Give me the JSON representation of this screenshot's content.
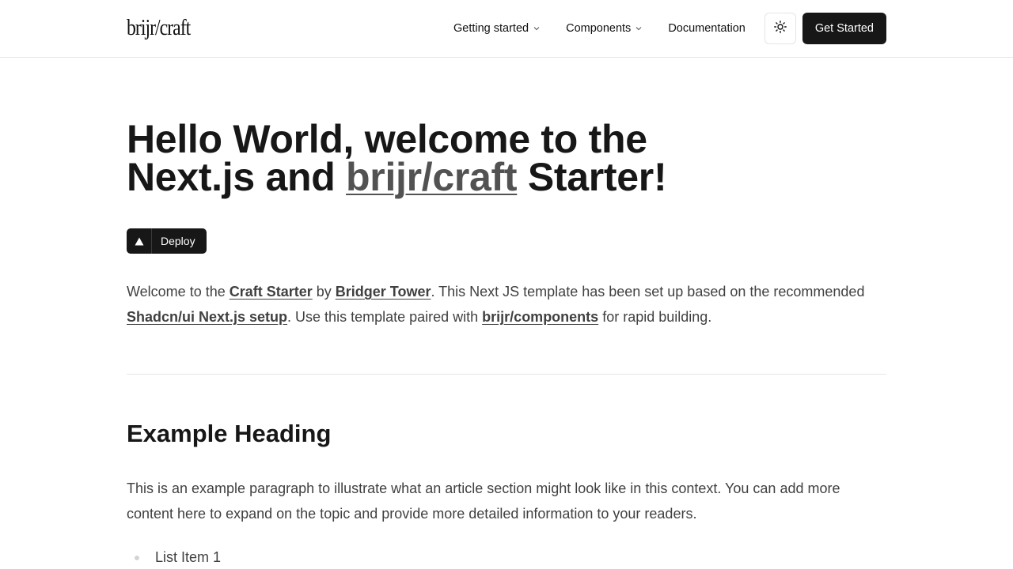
{
  "header": {
    "logo": "brijr/craft",
    "nav": [
      {
        "label": "Getting started",
        "has_dropdown": true
      },
      {
        "label": "Components",
        "has_dropdown": true
      },
      {
        "label": "Documentation",
        "has_dropdown": false
      }
    ],
    "theme_toggle_icon": "sun-icon",
    "cta_label": "Get Started"
  },
  "hero": {
    "line1": "Hello World, welcome to the",
    "line2_pre": "Next.js and ",
    "line2_link": "brijr/craft",
    "line2_post": " Starter!"
  },
  "deploy": {
    "icon": "vercel-triangle-icon",
    "label": "Deploy"
  },
  "intro": {
    "t1": "Welcome to the ",
    "link1": "Craft Starter",
    "t2": " by ",
    "link2": "Bridger Tower",
    "t3": ". This Next JS template has been set up based on the recommended ",
    "link3": "Shadcn/ui Next.js setup",
    "t4": ". Use this template paired with ",
    "link4": "brijr/components",
    "t5": " for rapid building."
  },
  "article": {
    "heading": "Example Heading",
    "paragraph": "This is an example paragraph to illustrate what an article section might look like in this context. You can add more content here to expand on the topic and provide more detailed information to your readers.",
    "list": [
      "List Item 1"
    ]
  },
  "colors": {
    "primary": "#171717",
    "muted_text": "#404040",
    "border": "#e5e5e5"
  }
}
